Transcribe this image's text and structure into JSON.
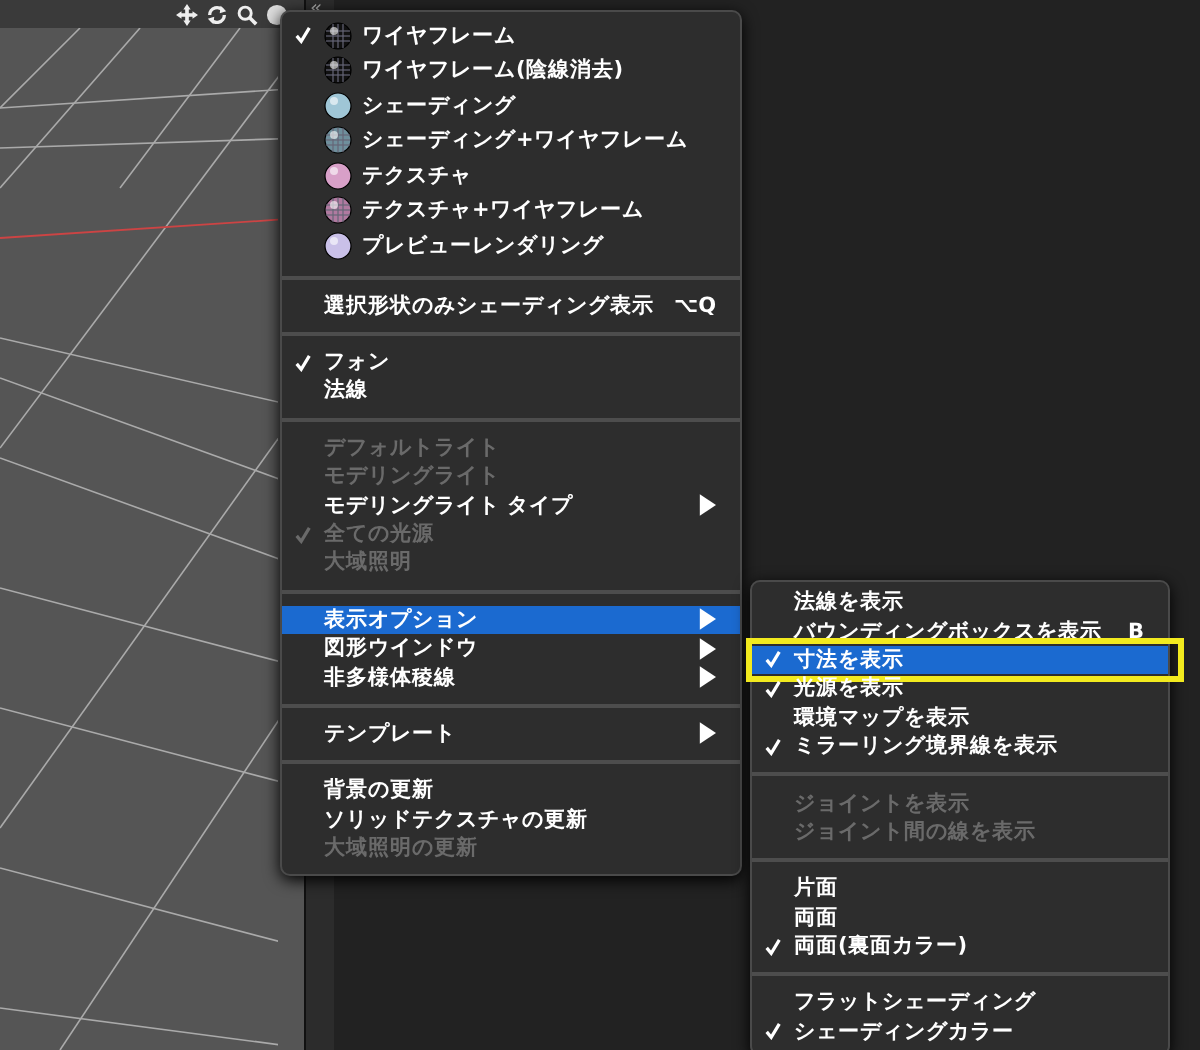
{
  "viewport": {
    "panel_toggle": "«"
  },
  "main_menu": {
    "sections": [
      {
        "items": [
          {
            "label": "ワイヤフレーム",
            "kind": "mode",
            "checked": true,
            "disabled": false,
            "selected": false
          },
          {
            "label": "ワイヤフレーム(陰線消去)",
            "kind": "mode",
            "checked": false,
            "disabled": false,
            "selected": false
          },
          {
            "label": "シェーディング",
            "kind": "mode",
            "checked": false,
            "disabled": false,
            "selected": false
          },
          {
            "label": "シェーディング+ワイヤフレーム",
            "kind": "mode",
            "checked": false,
            "disabled": false,
            "selected": false
          },
          {
            "label": "テクスチャ",
            "kind": "mode",
            "checked": false,
            "disabled": false,
            "selected": false
          },
          {
            "label": "テクスチャ+ワイヤフレーム",
            "kind": "mode",
            "checked": false,
            "disabled": false,
            "selected": false
          },
          {
            "label": "プレビューレンダリング",
            "kind": "mode",
            "checked": false,
            "disabled": false,
            "selected": false
          }
        ]
      },
      {
        "items": [
          {
            "label": "選択形状のみシェーディング表示",
            "kind": "plain",
            "shortcut": "⌥Q",
            "checked": false,
            "disabled": false,
            "selected": false
          }
        ]
      },
      {
        "items": [
          {
            "label": "フォン",
            "kind": "plain",
            "checked": true,
            "disabled": false,
            "selected": false
          },
          {
            "label": "法線",
            "kind": "plain",
            "checked": false,
            "disabled": false,
            "selected": false
          }
        ]
      },
      {
        "items": [
          {
            "label": "デフォルトライト",
            "kind": "plain",
            "checked": false,
            "disabled": true,
            "selected": false
          },
          {
            "label": "モデリングライト",
            "kind": "plain",
            "checked": false,
            "disabled": true,
            "selected": false
          },
          {
            "label": "モデリングライト タイプ",
            "kind": "plain",
            "submenu": true,
            "checked": false,
            "disabled": false,
            "selected": false
          },
          {
            "label": "全ての光源",
            "kind": "plain",
            "checked": true,
            "disabled": true,
            "selected": false
          },
          {
            "label": "大域照明",
            "kind": "plain",
            "checked": false,
            "disabled": true,
            "selected": false
          }
        ]
      },
      {
        "items": [
          {
            "label": "表示オプション",
            "kind": "plain",
            "submenu": true,
            "checked": false,
            "disabled": false,
            "selected": true
          },
          {
            "label": "図形ウインドウ",
            "kind": "plain",
            "submenu": true,
            "checked": false,
            "disabled": false,
            "selected": false
          },
          {
            "label": "非多様体稜線",
            "kind": "plain",
            "submenu": true,
            "checked": false,
            "disabled": false,
            "selected": false
          }
        ]
      },
      {
        "items": [
          {
            "label": "テンプレート",
            "kind": "plain",
            "submenu": true,
            "checked": false,
            "disabled": false,
            "selected": false
          }
        ]
      },
      {
        "items": [
          {
            "label": "背景の更新",
            "kind": "plain",
            "checked": false,
            "disabled": false,
            "selected": false
          },
          {
            "label": "ソリッドテクスチャの更新",
            "kind": "plain",
            "checked": false,
            "disabled": false,
            "selected": false
          },
          {
            "label": "大域照明の更新",
            "kind": "plain",
            "checked": false,
            "disabled": true,
            "selected": false
          }
        ]
      }
    ]
  },
  "submenu": {
    "sections": [
      {
        "items": [
          {
            "label": "法線を表示",
            "checked": false,
            "disabled": false,
            "selected": false,
            "highlighted": false
          },
          {
            "label": "バウンディングボックスを表示",
            "shortcut": "B",
            "checked": false,
            "disabled": false,
            "selected": false,
            "highlighted": false
          },
          {
            "label": "寸法を表示",
            "checked": true,
            "disabled": false,
            "selected": true,
            "highlighted": true
          },
          {
            "label": "光源を表示",
            "checked": true,
            "disabled": false,
            "selected": false,
            "highlighted": false
          },
          {
            "label": "環境マップを表示",
            "checked": false,
            "disabled": false,
            "selected": false,
            "highlighted": false
          },
          {
            "label": "ミラーリング境界線を表示",
            "checked": true,
            "disabled": false,
            "selected": false,
            "highlighted": false
          }
        ]
      },
      {
        "items": [
          {
            "label": "ジョイントを表示",
            "checked": false,
            "disabled": true,
            "selected": false,
            "highlighted": false
          },
          {
            "label": "ジョイント間の線を表示",
            "checked": false,
            "disabled": true,
            "selected": false,
            "highlighted": false
          }
        ]
      },
      {
        "items": [
          {
            "label": "片面",
            "checked": false,
            "disabled": false,
            "selected": false,
            "highlighted": false
          },
          {
            "label": "両面",
            "checked": false,
            "disabled": false,
            "selected": false,
            "highlighted": false
          },
          {
            "label": "両面(裏面カラー)",
            "checked": true,
            "disabled": false,
            "selected": false,
            "highlighted": false
          }
        ]
      },
      {
        "items": [
          {
            "label": "フラットシェーディング",
            "checked": false,
            "disabled": false,
            "selected": false,
            "highlighted": false
          },
          {
            "label": "シェーディングカラー",
            "checked": true,
            "disabled": false,
            "selected": false,
            "highlighted": false
          }
        ]
      }
    ]
  }
}
